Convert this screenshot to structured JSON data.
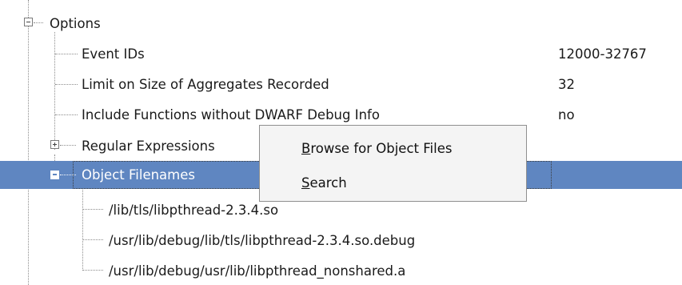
{
  "tree": {
    "options": {
      "label": "Options"
    },
    "event_ids": {
      "label": "Event IDs",
      "value": "12000-32767"
    },
    "limit_size": {
      "label": "Limit on Size of Aggregates Recorded",
      "value": "32"
    },
    "include_funcs": {
      "label": "Include Functions without DWARF Debug Info",
      "value": "no"
    },
    "regular_expressions": {
      "label": "Regular Expressions"
    },
    "object_filenames": {
      "label": "Object Filenames"
    },
    "files": [
      {
        "label": "/lib/tls/libpthread-2.3.4.so"
      },
      {
        "label": "/usr/lib/debug/lib/tls/libpthread-2.3.4.so.debug"
      },
      {
        "label": "/usr/lib/debug/usr/lib/libpthread_nonshared.a"
      }
    ]
  },
  "context_menu": {
    "browse": {
      "mnemonic": "B",
      "rest": "rowse for Object Files"
    },
    "search": {
      "mnemonic": "S",
      "rest": "earch"
    }
  },
  "colors": {
    "selection": "#5f86c1",
    "menu_background": "#f4f4f4"
  }
}
